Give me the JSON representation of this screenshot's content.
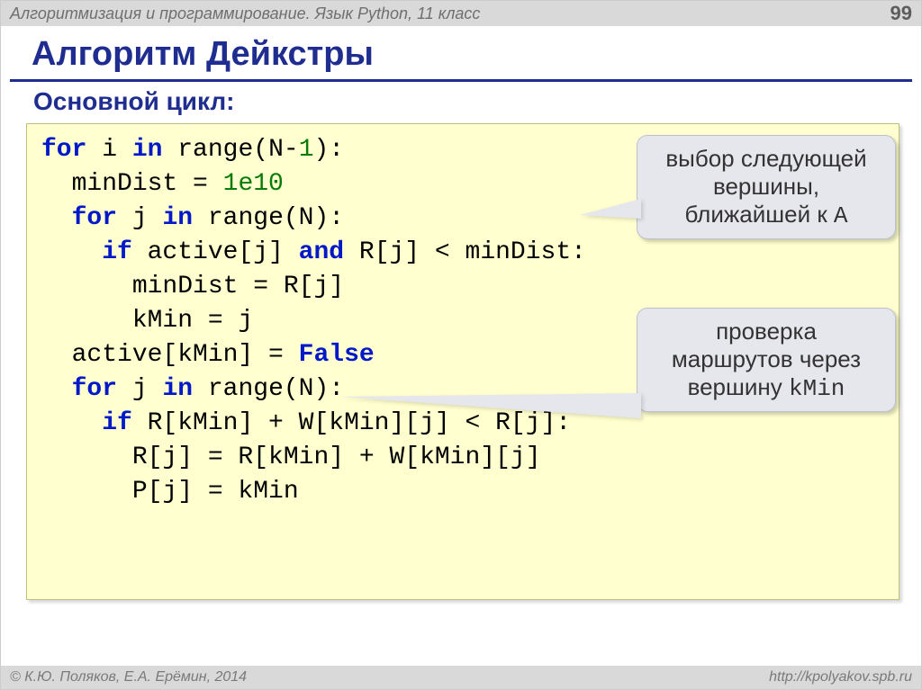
{
  "header": {
    "course": "Алгоритмизация и программирование. Язык Python, 11 класс",
    "page": "99"
  },
  "title": "Алгоритм Дейкстры",
  "subtitle": "Основной цикл:",
  "code": {
    "l1a": "for",
    "l1b": " i ",
    "l1c": "in",
    "l1d": " range(N-",
    "l1e": "1",
    "l1f": "):",
    "l2a": "  minDist = ",
    "l2b": "1e10",
    "l3a": "  ",
    "l3b": "for",
    "l3c": " j ",
    "l3d": "in",
    "l3e": " range(N):",
    "l4a": "    ",
    "l4b": "if",
    "l4c": " active[j] ",
    "l4d": "and",
    "l4e": " R[j] < minDist:",
    "l5": "      minDist = R[j]",
    "l6": "      kMin = j",
    "l7a": "  active[kMin] = ",
    "l7b": "False",
    "l8a": "  ",
    "l8b": "for",
    "l8c": " j ",
    "l8d": "in",
    "l8e": " range(N):",
    "l9a": "    ",
    "l9b": "if",
    "l9c": " R[kMin] + W[kMin][j] < R[j]:",
    "l10": "      R[j] = R[kMin] + W[kMin][j]",
    "l11": "      P[j] = kMin"
  },
  "callouts": {
    "c1_line1": "выбор следующей",
    "c1_line2": "вершины,",
    "c1_line3a": "ближайшей к ",
    "c1_line3b": "A",
    "c2_line1": "проверка",
    "c2_line2": "маршрутов через",
    "c2_line3a": "вершину ",
    "c2_line3b": "kMin"
  },
  "footer": {
    "left": "© К.Ю. Поляков, Е.А. Ерёмин, 2014",
    "right": "http://kpolyakov.spb.ru"
  }
}
